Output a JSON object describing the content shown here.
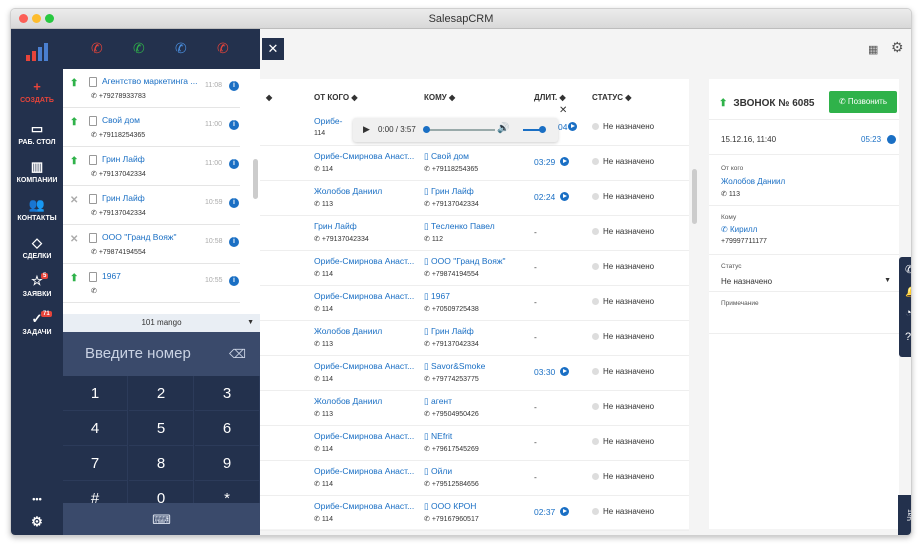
{
  "window": {
    "title": "SalesapCRM"
  },
  "nav": {
    "items": [
      {
        "label": "СОЗДАТЬ"
      },
      {
        "label": "РАБ. СТОЛ"
      },
      {
        "label": "КОМПАНИИ"
      },
      {
        "label": "КОНТАКТЫ"
      },
      {
        "label": "СДЕЛКИ"
      },
      {
        "label": "ЗАЯВКИ",
        "badge": "5"
      },
      {
        "label": "ЗАДАЧИ",
        "badge": "71"
      }
    ],
    "more": "•••"
  },
  "dialer": {
    "recent_calls": [
      {
        "name": "Агентство маркетинга ...",
        "phone": "+79278933783",
        "time": "11:08",
        "direction": "in"
      },
      {
        "name": "Свой дом",
        "phone": "+79118254365",
        "time": "11:00",
        "direction": "in"
      },
      {
        "name": "Грин Лайф",
        "phone": "+79137042334",
        "time": "11:00",
        "direction": "in"
      },
      {
        "name": "Грин Лайф",
        "phone": "+79137042334",
        "time": "10:59",
        "direction": "missed"
      },
      {
        "name": "ООО \"Гранд Вояж\"",
        "phone": "+79874194554",
        "time": "10:58",
        "direction": "missed"
      },
      {
        "name": "1967",
        "phone": "",
        "time": "10:55",
        "direction": "in"
      }
    ],
    "line": "101 mango",
    "number_placeholder": "Введите номер",
    "keys": [
      "1",
      "2",
      "3",
      "4",
      "5",
      "6",
      "7",
      "8",
      "9",
      "#",
      "0",
      "*"
    ]
  },
  "table": {
    "headers": {
      "from": "ОТ КОГО",
      "to": "КОМУ",
      "duration": "ДЛИТ.",
      "status": "СТАТУС"
    },
    "player": {
      "time": "0:00 / 3:57"
    },
    "rows": [
      {
        "from": "Орибе-Смирнова Анаст...",
        "from_sub": "114",
        "to": "Свой дом",
        "to_sub": "+79118254365",
        "duration": "03:29",
        "status": "Не назначено"
      },
      {
        "from": "Жолобов Даниил",
        "from_sub": "113",
        "to": "Грин Лайф",
        "to_sub": "+79137042334",
        "duration": "02:24",
        "status": "Не назначено"
      },
      {
        "from": "Грин Лайф",
        "from_sub": "+79137042334",
        "to": "Тесленко Павел",
        "to_sub": "112",
        "duration": "-",
        "status": "Не назначено"
      },
      {
        "from": "Орибе-Смирнова Анаст...",
        "from_sub": "114",
        "to": "ООО \"Гранд Вояж\"",
        "to_sub": "+79874194554",
        "duration": "-",
        "status": "Не назначено"
      },
      {
        "from": "Орибе-Смирнова Анаст...",
        "from_sub": "114",
        "to": "1967",
        "to_sub": "+70509725438",
        "duration": "-",
        "status": "Не назначено"
      },
      {
        "from": "Жолобов Даниил",
        "from_sub": "113",
        "to": "Грин Лайф",
        "to_sub": "+79137042334",
        "duration": "-",
        "status": "Не назначено"
      },
      {
        "from": "Орибе-Смирнова Анаст...",
        "from_sub": "114",
        "to": "Savor&Smoke",
        "to_sub": "+79774253775",
        "duration": "03:30",
        "status": "Не назначено"
      },
      {
        "from": "Жолобов Даниил",
        "from_sub": "113",
        "to": "агент",
        "to_sub": "+79504950426",
        "duration": "-",
        "status": "Не назначено"
      },
      {
        "from": "Орибе-Смирнова Анаст...",
        "from_sub": "114",
        "to": "NEfrit",
        "to_sub": "+79617545269",
        "duration": "-",
        "status": "Не назначено"
      },
      {
        "from": "Орибе-Смирнова Анаст...",
        "from_sub": "114",
        "to": "Ойли",
        "to_sub": "+79512584656",
        "duration": "-",
        "status": "Не назначено"
      },
      {
        "from": "Орибе-Смирнова Анаст...",
        "from_sub": "114",
        "to": "ООО КРОН",
        "to_sub": "+79167960517",
        "duration": "02:37",
        "status": "Не назначено"
      }
    ],
    "first_row": {
      "from": "Орибе-",
      "from_sub": "114",
      "duration": "04",
      "status": "Не назначено"
    }
  },
  "detail": {
    "title": "ЗВОНОК № 6085",
    "call_button": "Позвонить",
    "datetime": "15.12.16, 11:40",
    "duration": "05:23",
    "from_label": "От кого",
    "from_name": "Жолобов Даниил",
    "from_ext": "113",
    "to_label": "Кому",
    "to_name": "Кирилл",
    "to_phone": "+79997711177",
    "status_label": "Статус",
    "status_value": "Не назначено",
    "note_label": "Примечание"
  },
  "right_tools": {
    "badge": "9"
  },
  "chat_label": "Чат",
  "colors": {
    "nav": "#23314d",
    "accent_green": "#2fb24a",
    "link": "#1a6fc4",
    "badge": "#e6443a"
  }
}
